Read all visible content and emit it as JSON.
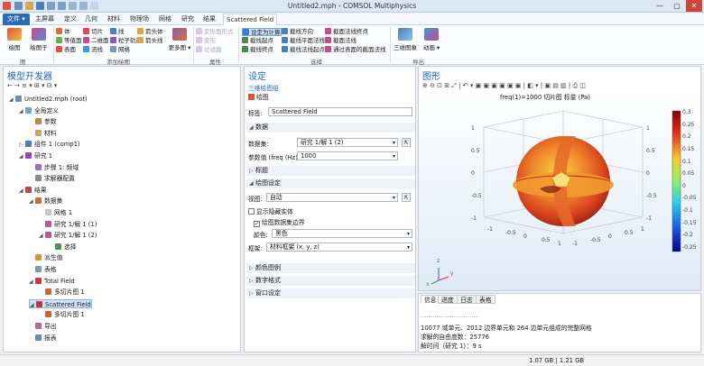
{
  "window": {
    "title": "Untitled2.mph - COMSOL Multiphysics",
    "minimize": "—",
    "maximize": "▢",
    "close": "✕"
  },
  "menu_tabs": [
    "文件 ▾",
    "主屏幕",
    "定义",
    "几何",
    "材料",
    "物理场",
    "网格",
    "研究",
    "结果",
    "Scattered Field"
  ],
  "ribbon": {
    "plot_label": "绘图",
    "plot_btn2_label": "绘图于",
    "add_plot_items": [
      "体",
      "切片",
      "线",
      "等值面",
      "箭头体",
      "二维面",
      "表面",
      "流线",
      "网格",
      "粒子轨迹",
      "箭头线"
    ],
    "more_plots": "更多图 ▾",
    "attribute_items": [
      "变形面形式",
      "变形",
      "过滤器"
    ],
    "selection_items": [
      "设定为计算",
      "截线方向",
      "截面法线终点",
      "截线起点",
      "截线平面法线",
      "截面法线",
      "截线终点",
      "截线法线起点",
      "通过表面的截面法线"
    ],
    "view3d": "三维图象",
    "animation": "动画 ▾",
    "group_labels": [
      "图",
      "添加绘图",
      "属性",
      "选择",
      "导出"
    ]
  },
  "model_builder": {
    "title": "模型开发器",
    "toolbar_glyphs": "← → ≡ ▾ ⊞ ▾ ⊟ ▾",
    "tree": [
      {
        "text": "Untitled2.mph (root)",
        "level": 0,
        "tw": "◢",
        "color": "#6c8fb8"
      },
      {
        "text": "全局定义",
        "level": 1,
        "tw": "◢",
        "color": "#7aa0c8"
      },
      {
        "text": "参数",
        "level": 2,
        "tw": "",
        "color": "#b48a4a"
      },
      {
        "text": "材料",
        "level": 2,
        "tw": "",
        "color": "#c7a86b"
      },
      {
        "text": "组件 1 (comp1)",
        "level": 1,
        "tw": "▷",
        "color": "#4a7fbf"
      },
      {
        "text": "研究 1",
        "level": 1,
        "tw": "◢",
        "color": "#8f4ab4"
      },
      {
        "text": "步骤 1: 频域",
        "level": 2,
        "tw": "",
        "color": "#a070c0"
      },
      {
        "text": "求解器配置",
        "level": 2,
        "tw": "",
        "color": "#8a8a8a"
      },
      {
        "text": "结果",
        "level": 1,
        "tw": "◢",
        "color": "#b44a4a"
      },
      {
        "text": "数据集",
        "level": 2,
        "tw": "◢",
        "color": "#c46a3a"
      },
      {
        "text": "网格 1",
        "level": 3,
        "tw": "",
        "color": "#c8c8c8"
      },
      {
        "text": "研究 1/解 1 (1)",
        "level": 3,
        "tw": "",
        "color": "#b05a9a"
      },
      {
        "text": "研究 1/解 1 (2)",
        "level": 3,
        "tw": "◢",
        "color": "#b05a9a"
      },
      {
        "text": "选择",
        "level": 4,
        "tw": "",
        "color": "#5a8a5a"
      },
      {
        "text": "派生值",
        "level": 2,
        "tw": "",
        "color": "#c49a3a"
      },
      {
        "text": "表格",
        "level": 2,
        "tw": "",
        "color": "#7a9ab8"
      },
      {
        "text": "Total Field",
        "level": 2,
        "tw": "◢",
        "color": "#c43a3a"
      },
      {
        "text": "多切片图 1",
        "level": 3,
        "tw": "",
        "color": "#c46a3a"
      },
      {
        "text": "Scattered Field",
        "level": 2,
        "tw": "◢",
        "color": "#c43a3a",
        "selected": true
      },
      {
        "text": "多切片图 1",
        "level": 3,
        "tw": "",
        "color": "#c46a3a"
      },
      {
        "text": "导出",
        "level": 2,
        "tw": "",
        "color": "#b06a9a"
      },
      {
        "text": "报表",
        "level": 2,
        "tw": "",
        "color": "#6a8ab0"
      }
    ]
  },
  "settings": {
    "title": "设定",
    "subtitle": "三维绘图组",
    "plot_link": "绘图",
    "label_caption": "标签:",
    "label_value": "Scattered Field",
    "sec_data": "数据",
    "dataset_caption": "数据集:",
    "dataset_value": "研究 1/解 1 (2)",
    "param_caption": "参数值 (freq (Hz)):",
    "param_value": "1000",
    "sec_title": "标题",
    "sec_plot": "绘图设定",
    "view_caption": "视图:",
    "view_value": "自动",
    "chk_hide": "显示隐藏实体",
    "chk_edges": "绘图数据集边界",
    "color_caption": "颜色:",
    "color_value": "黑色",
    "frame_caption": "框架:",
    "frame_value": "材料框架 (x, y, z)",
    "sec_legend": "颜色图例",
    "sec_number": "数字格式",
    "sec_window": "窗口设定"
  },
  "graphics": {
    "title": "图形",
    "toolbar_glyphs": "⊕ ⊖ ⊡ ⊞ ⤢ | ↶ ▾ ▣ ▣ ▣ ▣ ▣ ▣ | ◧ ▾ | ▣ ▤ ▥ | ⎙ ◫",
    "plot_title": "freq(1)=1000  切片图 标量 (Pa)",
    "colorbar_ticks": [
      "0.3",
      "0.25",
      "0.2",
      "0.15",
      "0.1",
      "0.05",
      "0",
      "-0.05",
      "-0.1",
      "-0.15",
      "-0.2",
      "-0.25"
    ],
    "axis_ticks": [
      "1",
      "0.5",
      "0",
      "-0.5",
      "-1",
      "-1",
      "-0.5",
      "0",
      "0.5",
      "1",
      "-1",
      "-0.5",
      "0",
      "0.5",
      "1",
      "1",
      "0.5",
      "0",
      "-0.5",
      "-1"
    ],
    "axis_letters": [
      "z",
      "y",
      "x"
    ]
  },
  "messages": {
    "tabs": [
      "信息",
      "进度",
      "日志",
      "表格"
    ],
    "lines": [
      "······························",
      "10077 域单元、2012 边界单元和 264 边单元组成的完整网格",
      "求解的自由度数：25776",
      "解时间（研究 1）：9 s"
    ]
  },
  "status": {
    "memory": "1.07 GB | 1.21 GB"
  },
  "colors": {
    "accent": "#2b6ab8",
    "panel_title": "#2266bb",
    "selection": "#cfe4fb"
  }
}
